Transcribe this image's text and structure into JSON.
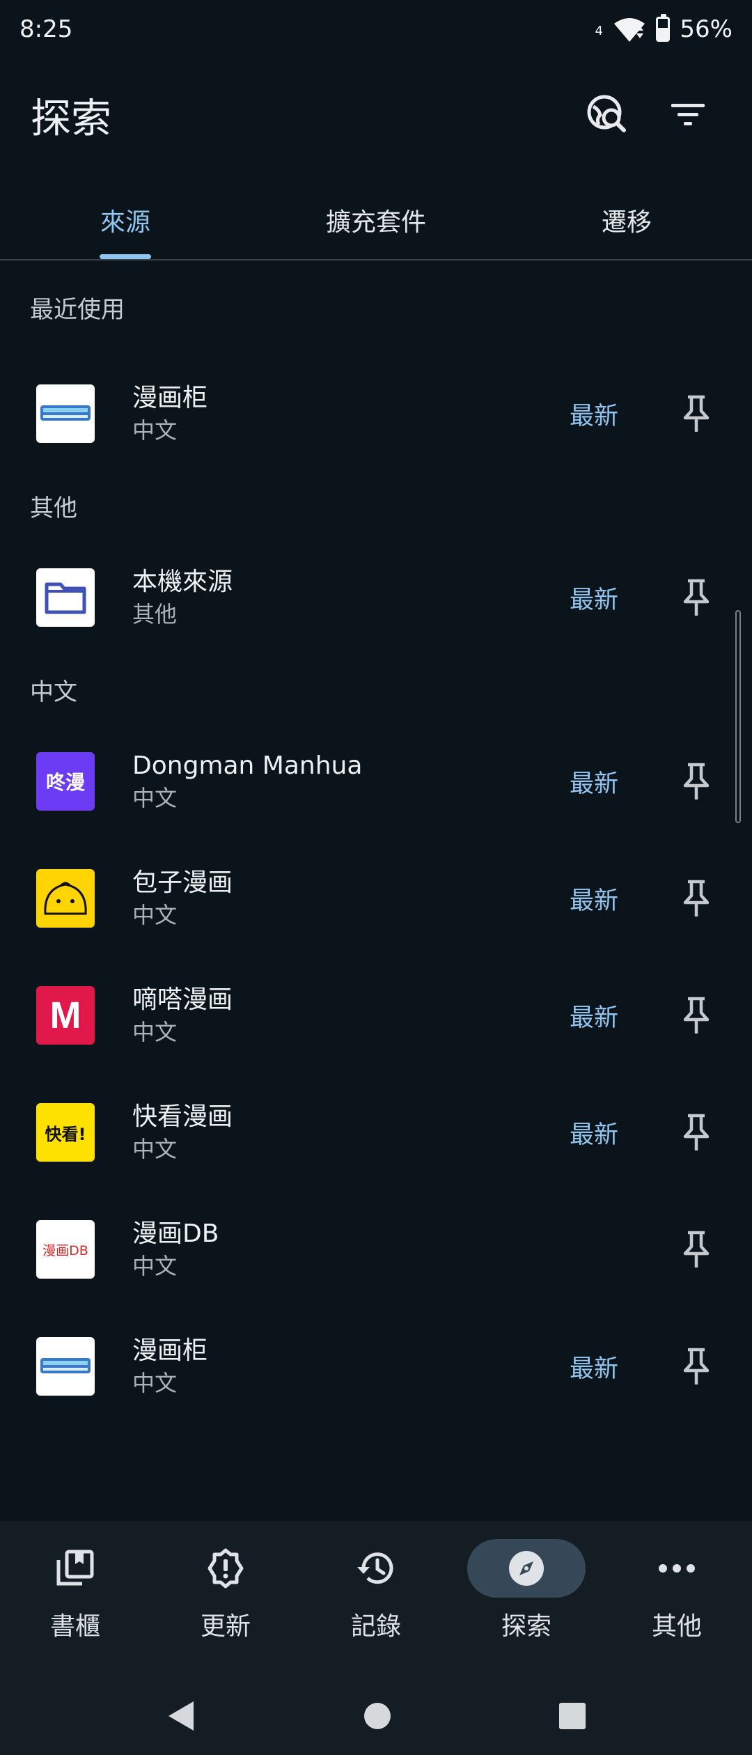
{
  "status": {
    "time": "8:25",
    "network": "4",
    "battery": "56%",
    "battery_level": 0.56
  },
  "appbar": {
    "title": "探索",
    "actions": [
      "globe-search-icon",
      "filter-icon"
    ]
  },
  "tabs": [
    {
      "label": "來源",
      "active": true
    },
    {
      "label": "擴充套件",
      "active": false
    },
    {
      "label": "遷移",
      "active": false
    }
  ],
  "sections": [
    {
      "title": "最近使用"
    },
    {
      "title": "其他"
    },
    {
      "title": "中文"
    }
  ],
  "sources": [
    {
      "name": "漫画柜",
      "lang": "中文",
      "latest": "最新",
      "logo": "manhuagui-logo"
    },
    {
      "name": "本機來源",
      "lang": "其他",
      "latest": "最新",
      "logo": "folder-icon"
    },
    {
      "name": "Dongman Manhua",
      "lang": "中文",
      "latest": "最新",
      "logo": "dongman-logo",
      "logo_text": "咚漫"
    },
    {
      "name": "包子漫画",
      "lang": "中文",
      "latest": "最新",
      "logo": "baozi-logo"
    },
    {
      "name": "嘀嗒漫画",
      "lang": "中文",
      "latest": "最新",
      "logo": "dida-logo",
      "logo_text": "M"
    },
    {
      "name": "快看漫画",
      "lang": "中文",
      "latest": "最新",
      "logo": "kuaikan-logo",
      "logo_text": "快看!"
    },
    {
      "name": "漫画DB",
      "lang": "中文",
      "latest": "",
      "logo": "manhuadb-logo",
      "logo_text": "漫画DB"
    },
    {
      "name": "漫画柜",
      "lang": "中文",
      "latest": "最新",
      "logo": "manhuagui-logo"
    }
  ],
  "bottom_nav": [
    {
      "label": "書櫃",
      "icon": "library-icon",
      "active": false
    },
    {
      "label": "更新",
      "icon": "alert-badge-icon",
      "active": false
    },
    {
      "label": "記錄",
      "icon": "history-icon",
      "active": false
    },
    {
      "label": "探索",
      "icon": "compass-icon",
      "active": true
    },
    {
      "label": "其他",
      "icon": "more-icon",
      "active": false
    }
  ],
  "colors": {
    "background": "#0c141b",
    "accent": "#8fc5ef",
    "nav_background": "#151d24"
  }
}
